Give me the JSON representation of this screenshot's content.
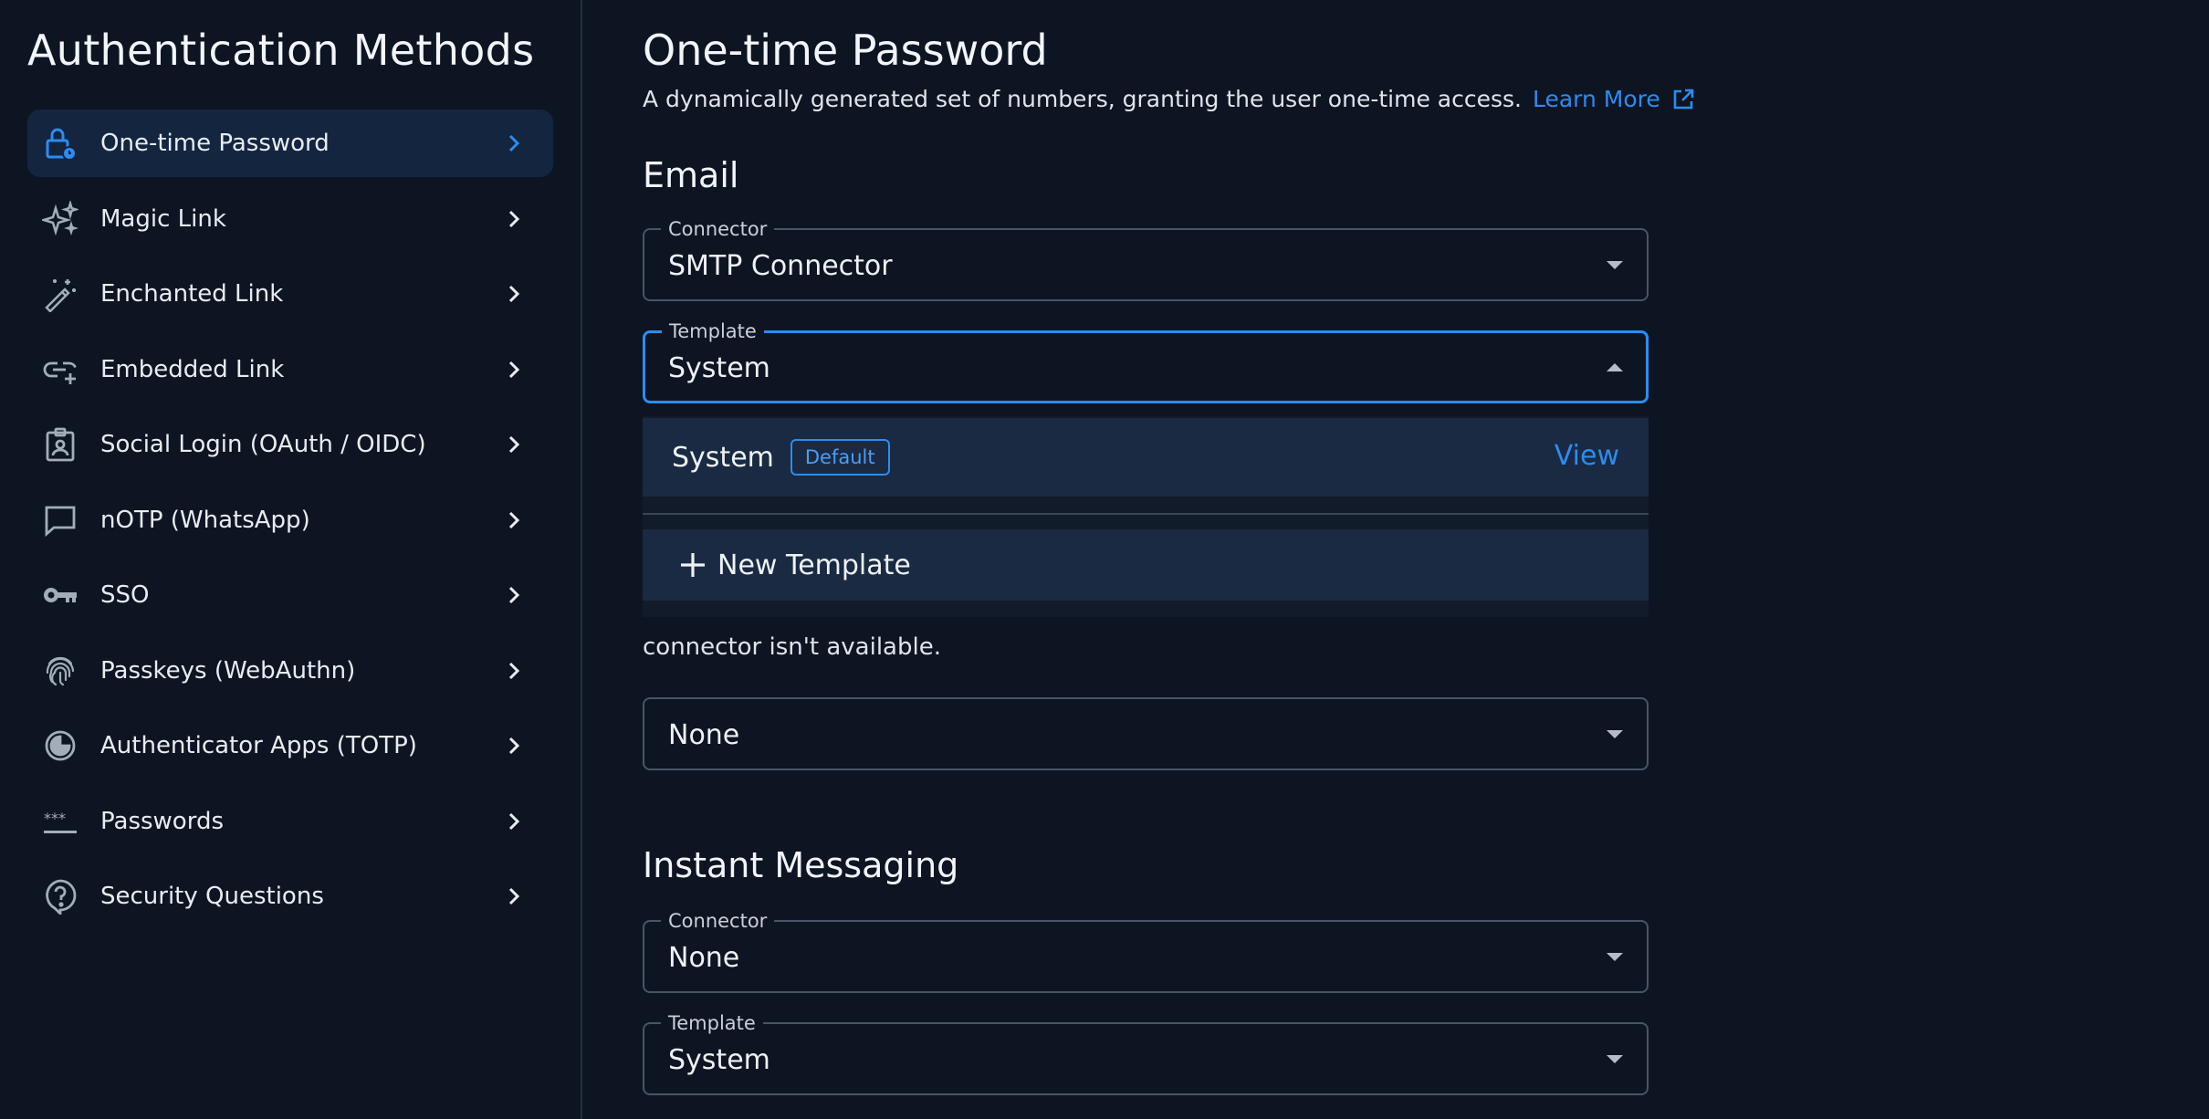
{
  "sidebar": {
    "title": "Authentication Methods",
    "items": [
      {
        "label": "One-time Password",
        "icon": "lock-clock-icon",
        "active": true
      },
      {
        "label": "Magic Link",
        "icon": "sparkles-icon"
      },
      {
        "label": "Enchanted Link",
        "icon": "magic-wand-icon"
      },
      {
        "label": "Embedded Link",
        "icon": "link-plus-icon"
      },
      {
        "label": "Social Login (OAuth / OIDC)",
        "icon": "id-badge-icon"
      },
      {
        "label": "nOTP (WhatsApp)",
        "icon": "chat-bubble-icon"
      },
      {
        "label": "SSO",
        "icon": "key-icon"
      },
      {
        "label": "Passkeys (WebAuthn)",
        "icon": "fingerprint-icon"
      },
      {
        "label": "Authenticator Apps (TOTP)",
        "icon": "authenticator-icon"
      },
      {
        "label": "Passwords",
        "icon": "password-dots-icon"
      },
      {
        "label": "Security Questions",
        "icon": "question-icon"
      }
    ]
  },
  "main": {
    "title": "One-time Password",
    "description": "A dynamically generated set of numbers, granting the user one-time access.",
    "learn_more": "Learn More",
    "email": {
      "section_title": "Email",
      "connector": {
        "label": "Connector",
        "value": "SMTP Connector"
      },
      "template": {
        "label": "Template",
        "value": "System"
      },
      "dropdown": {
        "option_label": "System",
        "option_badge": "Default",
        "option_action": "View",
        "new_template": "New Template"
      },
      "note": "connector isn't available.",
      "extra_select": {
        "value": "None"
      }
    },
    "instant_messaging": {
      "section_title": "Instant Messaging",
      "connector": {
        "label": "Connector",
        "value": "None"
      },
      "template": {
        "label": "Template",
        "value": "System"
      }
    }
  },
  "colors": {
    "background": "#0e1522",
    "accent": "#2d8cf0",
    "active_item_bg": "#14253f"
  }
}
